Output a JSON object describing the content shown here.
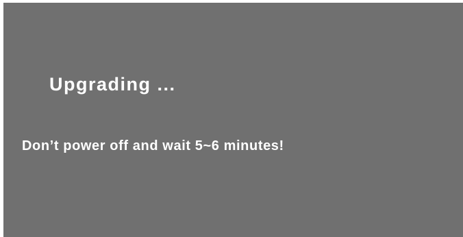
{
  "screen": {
    "title": "Upgrading ...",
    "message": "Don’t power off and wait 5~6 minutes!"
  },
  "colors": {
    "background": "#707070",
    "text": "#ffffff"
  }
}
